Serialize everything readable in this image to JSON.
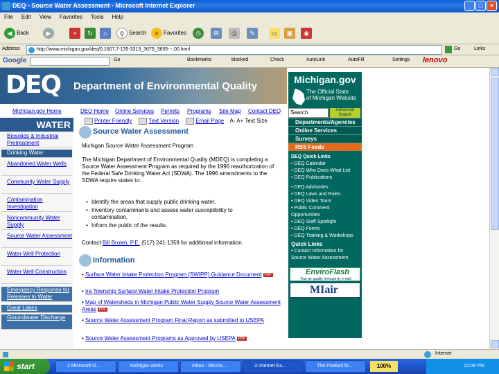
{
  "window": {
    "title": "DEQ - Source Water Assessment - Microsoft Internet Explorer",
    "minimize": "_",
    "maximize": "□",
    "close": "×"
  },
  "menu": [
    "File",
    "Edit",
    "View",
    "Favorites",
    "Tools",
    "Help"
  ],
  "toolbar": {
    "back": "Back",
    "search": "Search",
    "favorites": "Favorites"
  },
  "address": {
    "label": "Address",
    "url": "http://www.michigan.gov/deq/0,1607,7-135-3313_3675_3695---,00.html",
    "go": "Go",
    "links": "Links"
  },
  "google": {
    "label": "Google",
    "go": "Go",
    "bookmarks": "Bookmarks",
    "blocked": "blocked",
    "check": "Check",
    "autolink": "AutoLink",
    "autofill": "AutoFill",
    "settings": "Settings",
    "lenovo": "lenovo"
  },
  "page": {
    "logo": "DEQ",
    "department": "Department of Environmental Quality",
    "michigan_gov": "Michigan.gov",
    "state_line1": "The Official State",
    "state_line2": "of Michigan Website",
    "search_value": "Search",
    "advanced": "Advanced Search",
    "michigan_home": "Michigan.gov Home",
    "top_nav": [
      "DEQ Home",
      "Online Services",
      "Permits",
      "Programs",
      "Site Map",
      "Contact DEQ"
    ],
    "printer_friendly": "Printer Friendly",
    "text_version": "Text Version",
    "email_page": "Email Page",
    "text_size": "A-  A+  Text Size",
    "section": "WATER",
    "left_nav": [
      "Biosolids & Industrial Pretreatment",
      "Drinking Water",
      "Abandoned Water Wells",
      "Community Water Supply",
      "Contamination Investigation",
      "Noncommunity Water Supply",
      "Source Water Assessment",
      "Water Well Protection",
      "Water Well Construction",
      "Emergency Response for Releases to Water",
      "Great Lakes",
      "Groundwater Discharge"
    ],
    "sw_title": "Source Water Assessment",
    "program_title": "Michigan Source Water Assessment Program",
    "intro": "The Michigan Department of Environmental Quality (MDEQ) is completing a Source Water Assessment Program as required by the 1996 reauthorization of the Federal Safe Drinking Water Act (SDWA). The 1996 amendments to the SDWA require states to:",
    "bullets": [
      "Identify the areas that supply public drinking water,",
      "Inventory contaminants and assess water susceptibility to contamination,",
      "Inform the public of the results."
    ],
    "contact_pre": "Contact ",
    "contact_name": "Bill Brown, P.E.",
    "contact_post": " (517) 241-1359 for additional information.",
    "info_title": "Information",
    "info_items": [
      "Surface Water Intake Protection Program (SWIPP) Guidance Document",
      "Ira Township Surface Water Intake Protection Program",
      "Map of Watersheds in Michigan Public Water Supply Source Water Assessment Areas",
      "Source Water Assessment Program Final Report as submitted to USEPA",
      "Source Water Assessment Programs as Approved by USEPA"
    ],
    "pdf": "PDF",
    "right_nav": [
      "Departments/Agencies",
      "Online Services",
      "Surveys",
      "RSS Feeds"
    ],
    "quick_links_title": "DEQ Quick Links",
    "quick_links": [
      "• DEQ Calendar",
      "• DEQ Who Does What List",
      "• DEQ Publications",
      "• DEQ Advisories",
      "• DEQ Laws and Rules",
      "• DEQ Video Tours",
      "• Public Comment",
      "  Opportunities",
      "• DEQ Staff Spotlight",
      "• DEQ Forms",
      "• DEQ Training & Workshops"
    ],
    "quick_links2_title": "Quick Links",
    "quick_links2": [
      "• Contact Information for",
      "  Source Water Assessment"
    ],
    "enviroflash": "EnviroFlash",
    "enviroflash_sub": "Your air quality forecast by e-mail",
    "miair": "MIair"
  },
  "status": {
    "zone": "Internet"
  },
  "taskbar": {
    "start": "start",
    "tasks": [
      "2 Microsoft O...",
      "michigan works",
      "Inbox - Micros...",
      "3 Internet Ex...",
      "The Product fo..."
    ],
    "zoom": "100%",
    "clock": "12:08 PM"
  },
  "colors": {
    "deq_blue": "#2b5b8e",
    "michigan_teal": "#00685f",
    "rss_orange": "#e36b1b",
    "xp_blue": "#245edb",
    "start_green": "#3c9a3c"
  }
}
